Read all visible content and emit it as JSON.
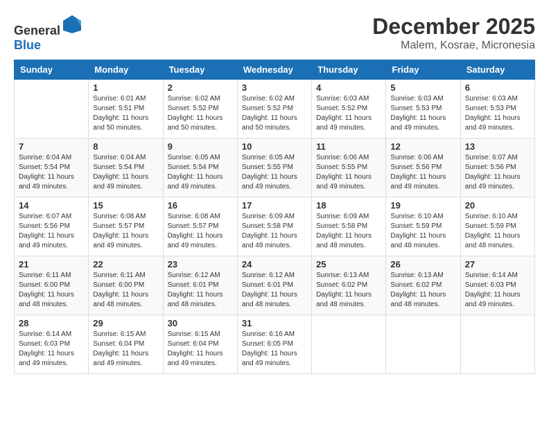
{
  "header": {
    "logo_general": "General",
    "logo_blue": "Blue",
    "month": "December 2025",
    "location": "Malem, Kosrae, Micronesia"
  },
  "weekdays": [
    "Sunday",
    "Monday",
    "Tuesday",
    "Wednesday",
    "Thursday",
    "Friday",
    "Saturday"
  ],
  "weeks": [
    [
      {
        "day": "",
        "sunrise": "",
        "sunset": "",
        "daylight": ""
      },
      {
        "day": "1",
        "sunrise": "Sunrise: 6:01 AM",
        "sunset": "Sunset: 5:51 PM",
        "daylight": "Daylight: 11 hours and 50 minutes."
      },
      {
        "day": "2",
        "sunrise": "Sunrise: 6:02 AM",
        "sunset": "Sunset: 5:52 PM",
        "daylight": "Daylight: 11 hours and 50 minutes."
      },
      {
        "day": "3",
        "sunrise": "Sunrise: 6:02 AM",
        "sunset": "Sunset: 5:52 PM",
        "daylight": "Daylight: 11 hours and 50 minutes."
      },
      {
        "day": "4",
        "sunrise": "Sunrise: 6:03 AM",
        "sunset": "Sunset: 5:52 PM",
        "daylight": "Daylight: 11 hours and 49 minutes."
      },
      {
        "day": "5",
        "sunrise": "Sunrise: 6:03 AM",
        "sunset": "Sunset: 5:53 PM",
        "daylight": "Daylight: 11 hours and 49 minutes."
      },
      {
        "day": "6",
        "sunrise": "Sunrise: 6:03 AM",
        "sunset": "Sunset: 5:53 PM",
        "daylight": "Daylight: 11 hours and 49 minutes."
      }
    ],
    [
      {
        "day": "7",
        "sunrise": "Sunrise: 6:04 AM",
        "sunset": "Sunset: 5:54 PM",
        "daylight": "Daylight: 11 hours and 49 minutes."
      },
      {
        "day": "8",
        "sunrise": "Sunrise: 6:04 AM",
        "sunset": "Sunset: 5:54 PM",
        "daylight": "Daylight: 11 hours and 49 minutes."
      },
      {
        "day": "9",
        "sunrise": "Sunrise: 6:05 AM",
        "sunset": "Sunset: 5:54 PM",
        "daylight": "Daylight: 11 hours and 49 minutes."
      },
      {
        "day": "10",
        "sunrise": "Sunrise: 6:05 AM",
        "sunset": "Sunset: 5:55 PM",
        "daylight": "Daylight: 11 hours and 49 minutes."
      },
      {
        "day": "11",
        "sunrise": "Sunrise: 6:06 AM",
        "sunset": "Sunset: 5:55 PM",
        "daylight": "Daylight: 11 hours and 49 minutes."
      },
      {
        "day": "12",
        "sunrise": "Sunrise: 6:06 AM",
        "sunset": "Sunset: 5:56 PM",
        "daylight": "Daylight: 11 hours and 49 minutes."
      },
      {
        "day": "13",
        "sunrise": "Sunrise: 6:07 AM",
        "sunset": "Sunset: 5:56 PM",
        "daylight": "Daylight: 11 hours and 49 minutes."
      }
    ],
    [
      {
        "day": "14",
        "sunrise": "Sunrise: 6:07 AM",
        "sunset": "Sunset: 5:56 PM",
        "daylight": "Daylight: 11 hours and 49 minutes."
      },
      {
        "day": "15",
        "sunrise": "Sunrise: 6:08 AM",
        "sunset": "Sunset: 5:57 PM",
        "daylight": "Daylight: 11 hours and 49 minutes."
      },
      {
        "day": "16",
        "sunrise": "Sunrise: 6:08 AM",
        "sunset": "Sunset: 5:57 PM",
        "daylight": "Daylight: 11 hours and 49 minutes."
      },
      {
        "day": "17",
        "sunrise": "Sunrise: 6:09 AM",
        "sunset": "Sunset: 5:58 PM",
        "daylight": "Daylight: 11 hours and 48 minutes."
      },
      {
        "day": "18",
        "sunrise": "Sunrise: 6:09 AM",
        "sunset": "Sunset: 5:58 PM",
        "daylight": "Daylight: 11 hours and 48 minutes."
      },
      {
        "day": "19",
        "sunrise": "Sunrise: 6:10 AM",
        "sunset": "Sunset: 5:59 PM",
        "daylight": "Daylight: 11 hours and 48 minutes."
      },
      {
        "day": "20",
        "sunrise": "Sunrise: 6:10 AM",
        "sunset": "Sunset: 5:59 PM",
        "daylight": "Daylight: 11 hours and 48 minutes."
      }
    ],
    [
      {
        "day": "21",
        "sunrise": "Sunrise: 6:11 AM",
        "sunset": "Sunset: 6:00 PM",
        "daylight": "Daylight: 11 hours and 48 minutes."
      },
      {
        "day": "22",
        "sunrise": "Sunrise: 6:11 AM",
        "sunset": "Sunset: 6:00 PM",
        "daylight": "Daylight: 11 hours and 48 minutes."
      },
      {
        "day": "23",
        "sunrise": "Sunrise: 6:12 AM",
        "sunset": "Sunset: 6:01 PM",
        "daylight": "Daylight: 11 hours and 48 minutes."
      },
      {
        "day": "24",
        "sunrise": "Sunrise: 6:12 AM",
        "sunset": "Sunset: 6:01 PM",
        "daylight": "Daylight: 11 hours and 48 minutes."
      },
      {
        "day": "25",
        "sunrise": "Sunrise: 6:13 AM",
        "sunset": "Sunset: 6:02 PM",
        "daylight": "Daylight: 11 hours and 48 minutes."
      },
      {
        "day": "26",
        "sunrise": "Sunrise: 6:13 AM",
        "sunset": "Sunset: 6:02 PM",
        "daylight": "Daylight: 11 hours and 48 minutes."
      },
      {
        "day": "27",
        "sunrise": "Sunrise: 6:14 AM",
        "sunset": "Sunset: 6:03 PM",
        "daylight": "Daylight: 11 hours and 49 minutes."
      }
    ],
    [
      {
        "day": "28",
        "sunrise": "Sunrise: 6:14 AM",
        "sunset": "Sunset: 6:03 PM",
        "daylight": "Daylight: 11 hours and 49 minutes."
      },
      {
        "day": "29",
        "sunrise": "Sunrise: 6:15 AM",
        "sunset": "Sunset: 6:04 PM",
        "daylight": "Daylight: 11 hours and 49 minutes."
      },
      {
        "day": "30",
        "sunrise": "Sunrise: 6:15 AM",
        "sunset": "Sunset: 6:04 PM",
        "daylight": "Daylight: 11 hours and 49 minutes."
      },
      {
        "day": "31",
        "sunrise": "Sunrise: 6:16 AM",
        "sunset": "Sunset: 6:05 PM",
        "daylight": "Daylight: 11 hours and 49 minutes."
      },
      {
        "day": "",
        "sunrise": "",
        "sunset": "",
        "daylight": ""
      },
      {
        "day": "",
        "sunrise": "",
        "sunset": "",
        "daylight": ""
      },
      {
        "day": "",
        "sunrise": "",
        "sunset": "",
        "daylight": ""
      }
    ]
  ]
}
